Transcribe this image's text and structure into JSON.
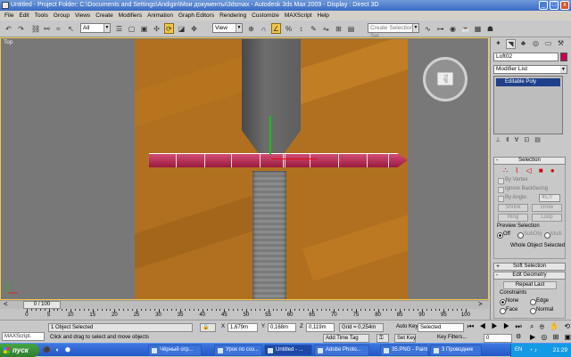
{
  "window": {
    "title": "Untitled  - Project Folder: C:\\Documents and Settings\\Andigin\\Мои документы\\3dsmax     - Autodesk 3ds Max  2009     - Display : Direct 3D",
    "min": "_",
    "max": "□",
    "close": "x"
  },
  "menu": [
    "File",
    "Edit",
    "Tools",
    "Group",
    "Views",
    "Create",
    "Modifiers",
    "Animation",
    "Graph Editors",
    "Rendering",
    "Customize",
    "MAXScript",
    "Help"
  ],
  "toolbar": {
    "filter": "All",
    "refcoord": "View",
    "named_selection_placeholder": "Create Selection Set"
  },
  "viewport": {
    "label": "Top",
    "viewcube_label": "TOP"
  },
  "command_panel": {
    "object_name": "Loft02",
    "object_color": "#c80050",
    "modifier_list": "Modifier List",
    "stack_item": "Editable Poly",
    "selection": {
      "title": "Selection",
      "by_vertex": "By Vertex",
      "ignore_backfacing": "Ignore Backfacing",
      "by_angle": "By Angle:",
      "by_angle_value": "45,0",
      "shrink": "Shrink",
      "grow": "Grow",
      "ring": "Ring",
      "loop": "Loop",
      "preview_title": "Preview Selection",
      "preview_off": "Off",
      "preview_subobj": "SubObj",
      "preview_multi": "Multi",
      "status": "Whole Object Selected"
    },
    "soft_selection": "Soft Selection",
    "edit_geometry": {
      "title": "Edit Geometry",
      "repeat_last": "Repeat Last",
      "constraints_title": "Constraints",
      "none": "None",
      "edge": "Edge",
      "face": "Face",
      "normal": "Normal"
    }
  },
  "timeline": {
    "slider": "0 / 100",
    "ticks": [
      "0",
      "5",
      "10",
      "15",
      "20",
      "25",
      "30",
      "35",
      "40",
      "45",
      "50",
      "55",
      "60",
      "65",
      "70",
      "75",
      "80",
      "85",
      "90",
      "95",
      "100"
    ]
  },
  "status": {
    "maxscript": "MAXScript.",
    "selected": "1 Object Selected",
    "prompt": "Click and drag to select and move objects",
    "x_label": "X",
    "x": "1,679m",
    "y_label": "Y",
    "y": "0,168m",
    "z_label": "Z",
    "z": "0,119m",
    "grid": "Grid = 0,254m",
    "add_time_tag": "Add Time Tag",
    "auto_key": "Auto Key",
    "auto_key_value": "Selected",
    "set_key": "Set Key",
    "key_filters": "Key Filters...",
    "frame": "0"
  },
  "taskbar": {
    "start": "пуск",
    "tasks": [
      "Чёрный отр...",
      "Урок по соз...",
      "Untitled - ...",
      "Adobe Photo...",
      "35.PNG - Paint",
      "3 Проводник"
    ],
    "lang": "EN",
    "clock": "21:29"
  }
}
